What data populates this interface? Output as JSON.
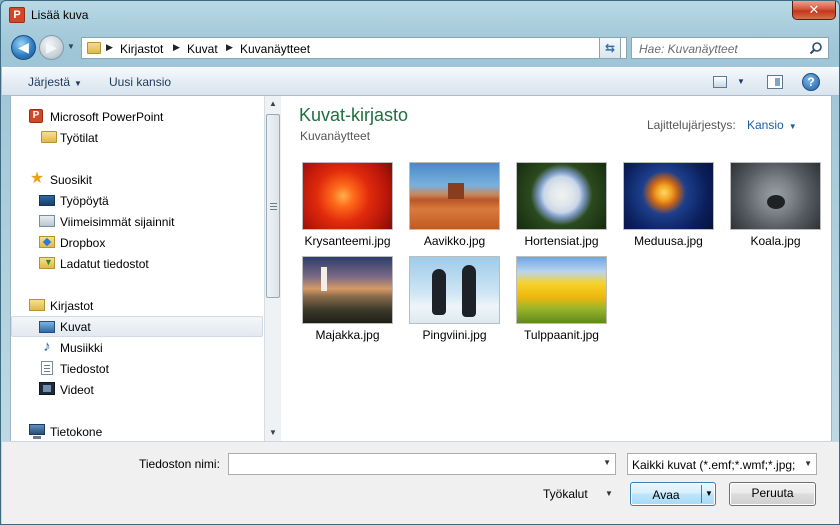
{
  "window": {
    "title": "Lisää kuva",
    "app_icon_letter": "P",
    "close_glyph": "✕"
  },
  "address": {
    "breadcrumbs": [
      "Kirjastot",
      "Kuvat",
      "Kuvanäytteet"
    ],
    "search_placeholder": "Hae: Kuvanäytteet"
  },
  "toolbar": {
    "organize_label": "Järjestä",
    "new_folder_label": "Uusi kansio",
    "help_glyph": "?"
  },
  "sidebar": {
    "items": [
      {
        "label": "Microsoft PowerPoint",
        "icon": "powerpoint-icon"
      },
      {
        "label": "Työtilat",
        "icon": "folder-icon"
      },
      {
        "label": "Suosikit",
        "icon": "star-icon"
      },
      {
        "label": "Työpöytä",
        "icon": "desktop-icon"
      },
      {
        "label": "Viimeisimmät sijainnit",
        "icon": "recent-places-icon"
      },
      {
        "label": "Dropbox",
        "icon": "dropbox-icon"
      },
      {
        "label": "Ladatut tiedostot",
        "icon": "downloads-icon"
      },
      {
        "label": "Kirjastot",
        "icon": "libraries-icon"
      },
      {
        "label": "Kuvat",
        "icon": "pictures-icon",
        "selected": true
      },
      {
        "label": "Musiikki",
        "icon": "music-icon"
      },
      {
        "label": "Tiedostot",
        "icon": "documents-icon"
      },
      {
        "label": "Videot",
        "icon": "videos-icon"
      },
      {
        "label": "Tietokone",
        "icon": "computer-icon"
      }
    ]
  },
  "content": {
    "library_title": "Kuvat-kirjasto",
    "library_subtitle": "Kuvanäytteet",
    "sort_label": "Lajittelujärjestys:",
    "sort_value": "Kansio",
    "files": [
      {
        "name": "Krysanteemi.jpg"
      },
      {
        "name": "Aavikko.jpg"
      },
      {
        "name": "Hortensiat.jpg"
      },
      {
        "name": "Meduusa.jpg"
      },
      {
        "name": "Koala.jpg"
      },
      {
        "name": "Majakka.jpg"
      },
      {
        "name": "Pingviini.jpg"
      },
      {
        "name": "Tulppaanit.jpg"
      }
    ]
  },
  "footer": {
    "filename_label": "Tiedoston nimi:",
    "filename_value": "",
    "filter_value": "Kaikki kuvat (*.emf;*.wmf;*.jpg;",
    "tools_label": "Työkalut",
    "open_label": "Avaa",
    "cancel_label": "Peruuta"
  },
  "colors": {
    "library_title": "#1e6f3e",
    "link_blue": "#1b5ea6",
    "close_red": "#c2351a"
  }
}
